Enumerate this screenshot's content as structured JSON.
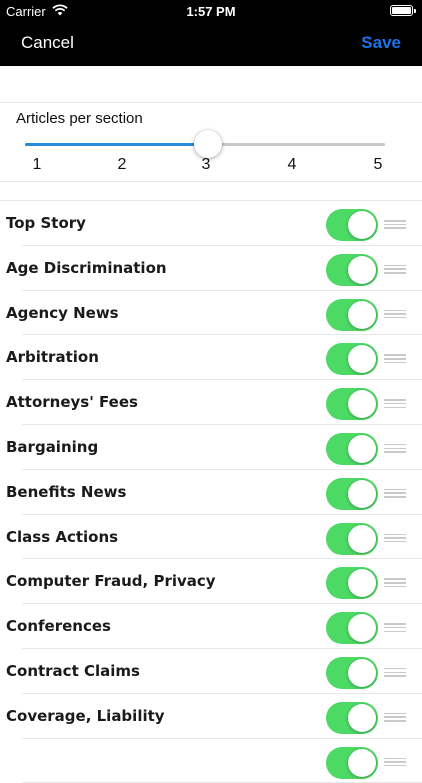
{
  "status_bar": {
    "carrier": "Carrier",
    "time": "1:57 PM",
    "wifi_icon": "wifi-icon",
    "battery_icon": "battery-icon"
  },
  "nav": {
    "cancel_label": "Cancel",
    "save_label": "Save",
    "save_color": "#1a73e8"
  },
  "slider": {
    "title": "Articles per section",
    "ticks": [
      "1",
      "2",
      "3",
      "4",
      "5"
    ],
    "min": 1,
    "max": 5,
    "value": 3,
    "fill_color": "#2a8ad6"
  },
  "toggle_color": "#4cd964",
  "sections": [
    {
      "label": "Top Story",
      "enabled": true
    },
    {
      "label": "Age Discrimination",
      "enabled": true
    },
    {
      "label": "Agency News",
      "enabled": true
    },
    {
      "label": "Arbitration",
      "enabled": true
    },
    {
      "label": "Attorneys' Fees",
      "enabled": true
    },
    {
      "label": "Bargaining",
      "enabled": true
    },
    {
      "label": "Benefits News",
      "enabled": true
    },
    {
      "label": "Class Actions",
      "enabled": true
    },
    {
      "label": "Computer Fraud, Privacy",
      "enabled": true
    },
    {
      "label": "Conferences",
      "enabled": true
    },
    {
      "label": "Contract Claims",
      "enabled": true
    },
    {
      "label": "Coverage, Liability",
      "enabled": true
    },
    {
      "label": "",
      "enabled": true
    }
  ]
}
